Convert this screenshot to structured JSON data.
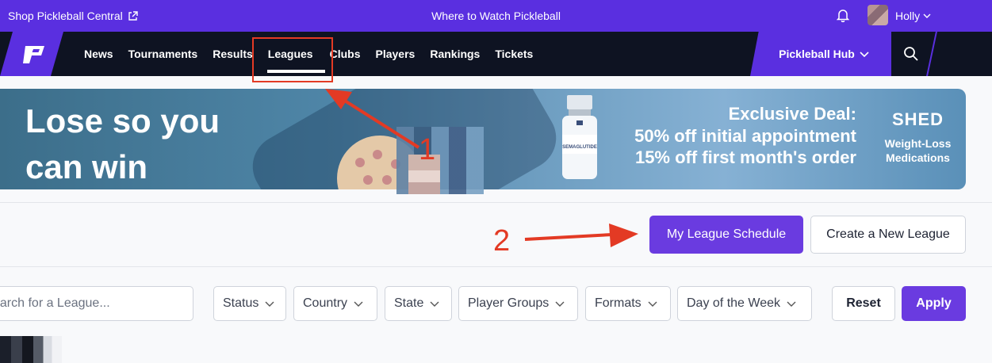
{
  "topbar": {
    "shop_label": "Shop Pickleball Central",
    "center_label": "Where to Watch Pickleball",
    "user_name": "Holly"
  },
  "nav": {
    "items": [
      {
        "label": "News"
      },
      {
        "label": "Tournaments"
      },
      {
        "label": "Results"
      },
      {
        "label": "Leagues"
      },
      {
        "label": "Clubs"
      },
      {
        "label": "Players"
      },
      {
        "label": "Rankings"
      },
      {
        "label": "Tickets"
      }
    ],
    "active": "Leagues",
    "hub_label": "Pickleball Hub"
  },
  "banner": {
    "headline_line1": "Lose so you",
    "headline_line2": "can win",
    "deal_title": "Exclusive Deal:",
    "deal_line1": "50% off initial appointment",
    "deal_line2": "15% off first month's order",
    "brand": "SHED",
    "brand_sub1": "Weight-Loss",
    "brand_sub2": "Medications",
    "vial_label": "SEMAGLUTIDE"
  },
  "actions": {
    "schedule_label": "My League Schedule",
    "create_label": "Create a New League"
  },
  "annotations": {
    "marker1": "1",
    "marker2": "2",
    "color": "#e33a24"
  },
  "filters": {
    "search_placeholder": "earch for a League...",
    "dropdowns": [
      {
        "label": "Status"
      },
      {
        "label": "Country"
      },
      {
        "label": "State"
      },
      {
        "label": "Player Groups"
      },
      {
        "label": "Formats"
      },
      {
        "label": "Day of the Week"
      }
    ],
    "reset_label": "Reset",
    "apply_label": "Apply"
  },
  "colors": {
    "brand_purple": "#5a2fe0",
    "button_purple": "#6a3be0",
    "nav_dark": "#0e1322"
  }
}
